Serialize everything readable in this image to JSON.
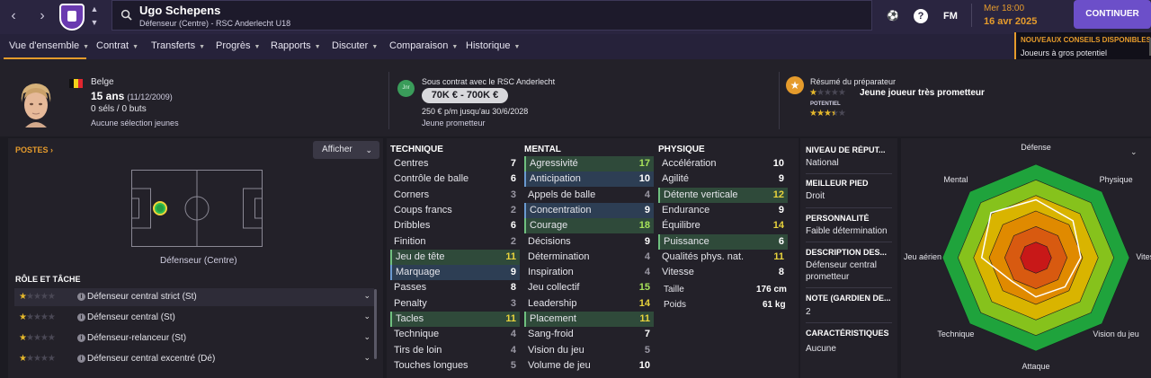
{
  "topbar": {
    "player_name": "Ugo Schepens",
    "player_sub": "Défenseur (Centre) - RSC Anderlecht U18",
    "date_line1": "Mer 18:00",
    "date_line2": "16 avr 2025",
    "continue_label": "CONTINUER",
    "fm_label": "FM"
  },
  "menu": {
    "items": [
      "Vue d'ensemble",
      "Contrat",
      "Transferts",
      "Progrès",
      "Rapports",
      "Discuter",
      "Comparaison",
      "Historique"
    ]
  },
  "advice": {
    "title": "NOUVEAUX CONSEILS DISPONIBLES",
    "text": "Joueurs à gros potentiel"
  },
  "profile": {
    "nationality": "Belge",
    "age": "15 ans",
    "dob": "(11/12/2009)",
    "caps": "0 séls / 0 buts",
    "youth": "Aucune sélection jeunes"
  },
  "contract": {
    "badge": "Jnr",
    "title": "Sous contrat avec le RSC Anderlecht",
    "value": "70K € - 700K €",
    "wage": "250 € p/m jusqu'au 30/6/2028",
    "status": "Jeune prometteur"
  },
  "scout": {
    "title": "Résumé du préparateur",
    "summary": "Jeune joueur très prometteur",
    "potential_label": "POTENTIEL",
    "ability_stars": 1,
    "potential_stars": 3.5
  },
  "positions": {
    "title": "POSTES",
    "show_button": "Afficher",
    "position_label": "Défenseur (Centre)"
  },
  "roles": {
    "title": "RÔLE ET TÂCHE",
    "items": [
      {
        "name": "Défenseur central strict (St)",
        "stars": 1
      },
      {
        "name": "Défenseur central (St)",
        "stars": 1
      },
      {
        "name": "Défenseur-relanceur (St)",
        "stars": 1
      },
      {
        "name": "Défenseur central excentré (Dé)",
        "stars": 1
      }
    ]
  },
  "attributes": {
    "technique": {
      "title": "TECHNIQUE",
      "rows": [
        {
          "name": "Centres",
          "value": "7",
          "hl": ""
        },
        {
          "name": "Contrôle de balle",
          "value": "6",
          "hl": ""
        },
        {
          "name": "Corners",
          "value": "3",
          "hl": ""
        },
        {
          "name": "Coups francs",
          "value": "2",
          "hl": ""
        },
        {
          "name": "Dribbles",
          "value": "6",
          "hl": ""
        },
        {
          "name": "Finition",
          "value": "2",
          "hl": ""
        },
        {
          "name": "Jeu de tête",
          "value": "11",
          "hl": "g"
        },
        {
          "name": "Marquage",
          "value": "9",
          "hl": "b"
        },
        {
          "name": "Passes",
          "value": "8",
          "hl": ""
        },
        {
          "name": "Penalty",
          "value": "3",
          "hl": ""
        },
        {
          "name": "Tacles",
          "value": "11",
          "hl": "g"
        },
        {
          "name": "Technique",
          "value": "4",
          "hl": ""
        },
        {
          "name": "Tirs de loin",
          "value": "4",
          "hl": ""
        },
        {
          "name": "Touches longues",
          "value": "5",
          "hl": ""
        }
      ]
    },
    "mental": {
      "title": "MENTAL",
      "rows": [
        {
          "name": "Agressivité",
          "value": "17",
          "hl": "g"
        },
        {
          "name": "Anticipation",
          "value": "10",
          "hl": "b"
        },
        {
          "name": "Appels de balle",
          "value": "4",
          "hl": ""
        },
        {
          "name": "Concentration",
          "value": "9",
          "hl": "b"
        },
        {
          "name": "Courage",
          "value": "18",
          "hl": "g"
        },
        {
          "name": "Décisions",
          "value": "9",
          "hl": ""
        },
        {
          "name": "Détermination",
          "value": "4",
          "hl": ""
        },
        {
          "name": "Inspiration",
          "value": "4",
          "hl": ""
        },
        {
          "name": "Jeu collectif",
          "value": "15",
          "hl": ""
        },
        {
          "name": "Leadership",
          "value": "14",
          "hl": ""
        },
        {
          "name": "Placement",
          "value": "11",
          "hl": "g"
        },
        {
          "name": "Sang-froid",
          "value": "7",
          "hl": ""
        },
        {
          "name": "Vision du jeu",
          "value": "5",
          "hl": ""
        },
        {
          "name": "Volume de jeu",
          "value": "10",
          "hl": ""
        }
      ]
    },
    "physique": {
      "title": "PHYSIQUE",
      "rows": [
        {
          "name": "Accélération",
          "value": "10",
          "hl": ""
        },
        {
          "name": "Agilité",
          "value": "9",
          "hl": ""
        },
        {
          "name": "Détente verticale",
          "value": "12",
          "hl": "g"
        },
        {
          "name": "Endurance",
          "value": "9",
          "hl": ""
        },
        {
          "name": "Équilibre",
          "value": "14",
          "hl": ""
        },
        {
          "name": "Puissance",
          "value": "6",
          "hl": "g"
        },
        {
          "name": "Qualités phys. nat.",
          "value": "11",
          "hl": ""
        },
        {
          "name": "Vitesse",
          "value": "8",
          "hl": ""
        }
      ],
      "height_label": "Taille",
      "height": "176 cm",
      "weight_label": "Poids",
      "weight": "61 kg"
    }
  },
  "info": {
    "rep_title": "NIVEAU DE RÉPUT...",
    "rep_value": "National",
    "foot_title": "MEILLEUR PIED",
    "foot_value": "Droit",
    "pers_title": "PERSONNALITÉ",
    "pers_value": "Faible détermination",
    "desc_title": "DESCRIPTION DES...",
    "desc_value": "Défenseur central prometteur",
    "gk_title": "NOTE (GARDIEN DE...",
    "gk_value": "2",
    "char_title": "CARACTÉRISTIQUES ...",
    "char_value": "Aucune"
  },
  "radar": {
    "labels": [
      "Défense",
      "Physique",
      "Vitesse",
      "Vision du jeu",
      "Attaque",
      "Technique",
      "Jeu aérien",
      "Mental"
    ],
    "values": [
      0.62,
      0.56,
      0.48,
      0.44,
      0.42,
      0.36,
      0.58,
      0.68
    ],
    "ring_colors": [
      "#1fa33c",
      "#86c21c",
      "#d9b400",
      "#e08a00",
      "#d85a10",
      "#c81818"
    ]
  },
  "colors": {
    "accent": "#e59b2c",
    "value_green": "#a7e25a",
    "value_yellow": "#e8d33c"
  }
}
